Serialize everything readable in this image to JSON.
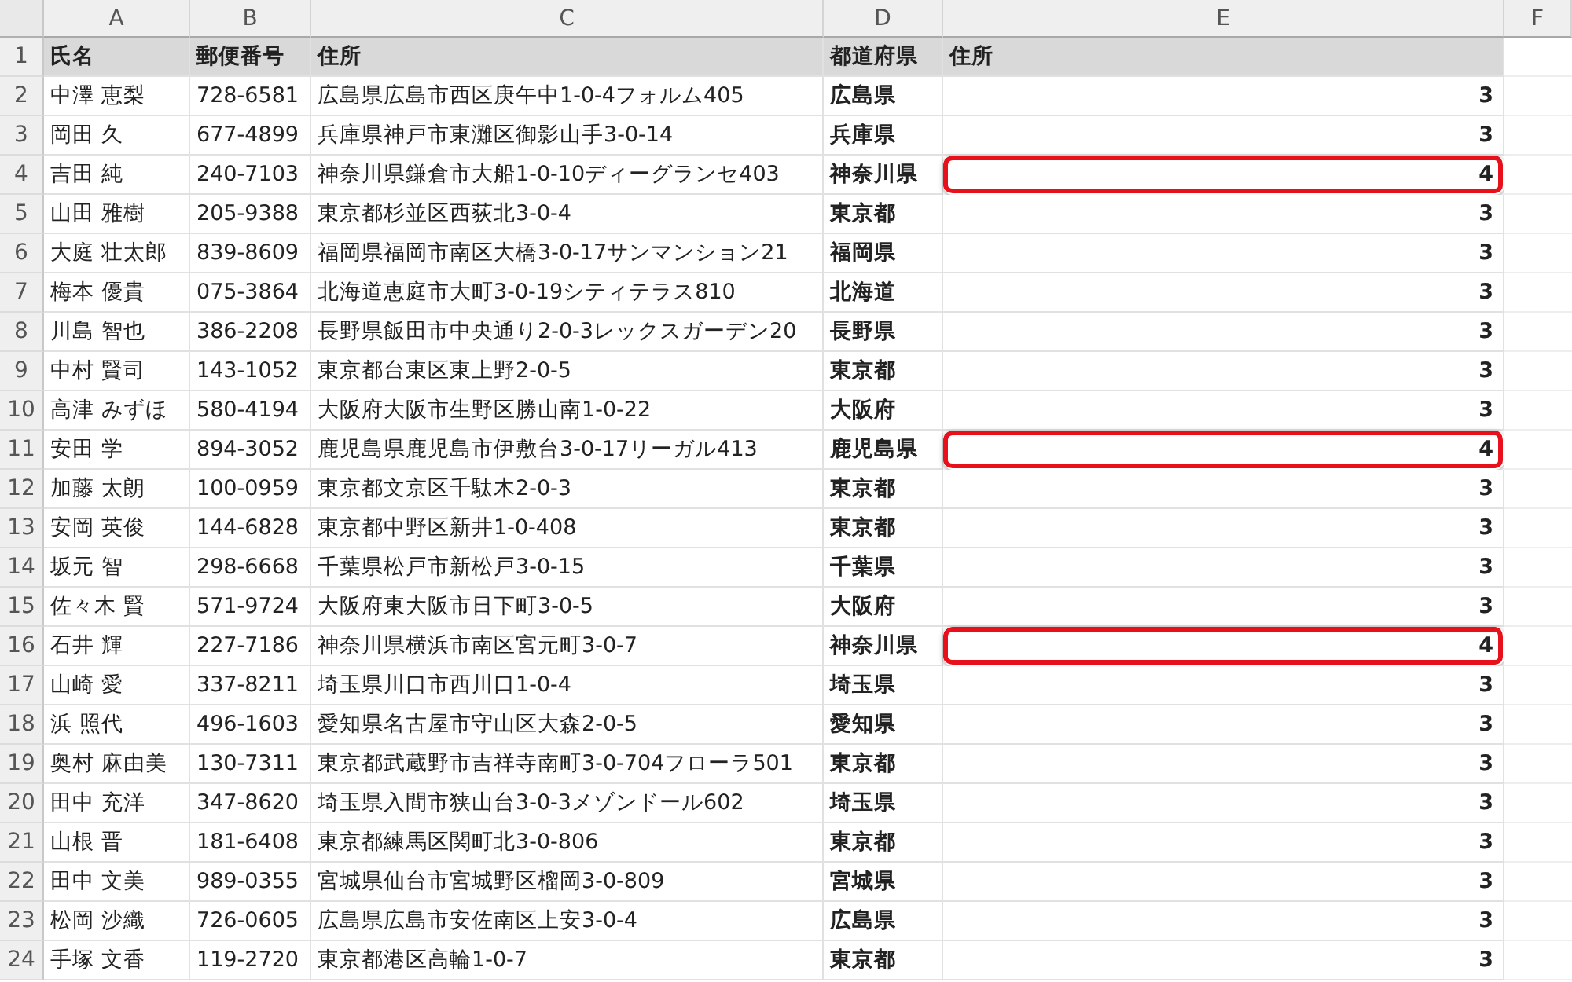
{
  "columns": [
    "A",
    "B",
    "C",
    "D",
    "E",
    "F"
  ],
  "header_row": {
    "number": "1",
    "cells": [
      "氏名",
      "郵便番号",
      "住所",
      "都道府県",
      "住所"
    ]
  },
  "rows": [
    {
      "number": "2",
      "name": "中澤 恵梨",
      "postal": "728-6581",
      "address": "広島県広島市西区庚午中1-0-4フォルム405",
      "prefecture": "広島県",
      "count": "3",
      "highlighted": false
    },
    {
      "number": "3",
      "name": "岡田 久",
      "postal": "677-4899",
      "address": "兵庫県神戸市東灘区御影山手3-0-14",
      "prefecture": "兵庫県",
      "count": "3",
      "highlighted": false
    },
    {
      "number": "4",
      "name": "吉田 純",
      "postal": "240-7103",
      "address": "神奈川県鎌倉市大船1-0-10ディーグランセ403",
      "prefecture": "神奈川県",
      "count": "4",
      "highlighted": true
    },
    {
      "number": "5",
      "name": "山田 雅樹",
      "postal": "205-9388",
      "address": "東京都杉並区西荻北3-0-4",
      "prefecture": "東京都",
      "count": "3",
      "highlighted": false
    },
    {
      "number": "6",
      "name": "大庭 壮太郎",
      "postal": "839-8609",
      "address": "福岡県福岡市南区大橋3-0-17サンマンション21",
      "prefecture": "福岡県",
      "count": "3",
      "highlighted": false
    },
    {
      "number": "7",
      "name": "梅本 優貴",
      "postal": "075-3864",
      "address": "北海道恵庭市大町3-0-19シティテラス810",
      "prefecture": "北海道",
      "count": "3",
      "highlighted": false
    },
    {
      "number": "8",
      "name": "川島 智也",
      "postal": "386-2208",
      "address": "長野県飯田市中央通り2-0-3レックスガーデン20",
      "prefecture": "長野県",
      "count": "3",
      "highlighted": false
    },
    {
      "number": "9",
      "name": "中村 賢司",
      "postal": "143-1052",
      "address": "東京都台東区東上野2-0-5",
      "prefecture": "東京都",
      "count": "3",
      "highlighted": false
    },
    {
      "number": "10",
      "name": "高津 みずほ",
      "postal": "580-4194",
      "address": "大阪府大阪市生野区勝山南1-0-22",
      "prefecture": "大阪府",
      "count": "3",
      "highlighted": false
    },
    {
      "number": "11",
      "name": "安田 学",
      "postal": "894-3052",
      "address": "鹿児島県鹿児島市伊敷台3-0-17リーガル413",
      "prefecture": "鹿児島県",
      "count": "4",
      "highlighted": true
    },
    {
      "number": "12",
      "name": "加藤 太朗",
      "postal": "100-0959",
      "address": "東京都文京区千駄木2-0-3",
      "prefecture": "東京都",
      "count": "3",
      "highlighted": false
    },
    {
      "number": "13",
      "name": "安岡 英俊",
      "postal": "144-6828",
      "address": "東京都中野区新井1-0-408",
      "prefecture": "東京都",
      "count": "3",
      "highlighted": false
    },
    {
      "number": "14",
      "name": "坂元 智",
      "postal": "298-6668",
      "address": "千葉県松戸市新松戸3-0-15",
      "prefecture": "千葉県",
      "count": "3",
      "highlighted": false
    },
    {
      "number": "15",
      "name": "佐々木 賢",
      "postal": "571-9724",
      "address": "大阪府東大阪市日下町3-0-5",
      "prefecture": "大阪府",
      "count": "3",
      "highlighted": false
    },
    {
      "number": "16",
      "name": "石井 輝",
      "postal": "227-7186",
      "address": "神奈川県横浜市南区宮元町3-0-7",
      "prefecture": "神奈川県",
      "count": "4",
      "highlighted": true
    },
    {
      "number": "17",
      "name": "山崎 愛",
      "postal": "337-8211",
      "address": "埼玉県川口市西川口1-0-4",
      "prefecture": "埼玉県",
      "count": "3",
      "highlighted": false
    },
    {
      "number": "18",
      "name": "浜 照代",
      "postal": "496-1603",
      "address": "愛知県名古屋市守山区大森2-0-5",
      "prefecture": "愛知県",
      "count": "3",
      "highlighted": false
    },
    {
      "number": "19",
      "name": "奥村 麻由美",
      "postal": "130-7311",
      "address": "東京都武蔵野市吉祥寺南町3-0-704フローラ501",
      "prefecture": "東京都",
      "count": "3",
      "highlighted": false
    },
    {
      "number": "20",
      "name": "田中 充洋",
      "postal": "347-8620",
      "address": "埼玉県入間市狭山台3-0-3メゾンドール602",
      "prefecture": "埼玉県",
      "count": "3",
      "highlighted": false
    },
    {
      "number": "21",
      "name": "山根 晋",
      "postal": "181-6408",
      "address": "東京都練馬区関町北3-0-806",
      "prefecture": "東京都",
      "count": "3",
      "highlighted": false
    },
    {
      "number": "22",
      "name": "田中 文美",
      "postal": "989-0355",
      "address": "宮城県仙台市宮城野区榴岡3-0-809",
      "prefecture": "宮城県",
      "count": "3",
      "highlighted": false
    },
    {
      "number": "23",
      "name": "松岡 沙織",
      "postal": "726-0605",
      "address": "広島県広島市安佐南区上安3-0-4",
      "prefecture": "広島県",
      "count": "3",
      "highlighted": false
    },
    {
      "number": "24",
      "name": "手塚 文香",
      "postal": "119-2720",
      "address": "東京都港区高輪1-0-7",
      "prefecture": "東京都",
      "count": "3",
      "highlighted": false
    }
  ]
}
